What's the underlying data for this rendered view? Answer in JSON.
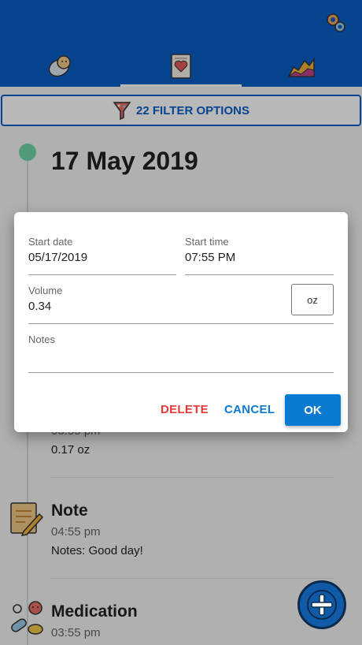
{
  "header": {
    "settings_icon": "gear-icon",
    "tabs": [
      {
        "icon": "baby-icon"
      },
      {
        "icon": "diary-icon",
        "active": true
      },
      {
        "icon": "chart-icon"
      }
    ]
  },
  "filter": {
    "label": "22 FILTER OPTIONS",
    "icon": "funnel-icon"
  },
  "timeline": {
    "date_heading": "17 May 2019",
    "entries": [
      {
        "title": "",
        "time": "03:55 pm",
        "text": "0.17 oz"
      },
      {
        "title": "Note",
        "time": "04:55 pm",
        "text": "Notes: Good day!"
      },
      {
        "title": "Medication",
        "time": "03:55 pm",
        "text": ""
      }
    ]
  },
  "dialog": {
    "start_date_label": "Start date",
    "start_date_value": "05/17/2019",
    "start_time_label": "Start time",
    "start_time_value": "07:55 PM",
    "volume_label": "Volume",
    "volume_value": "0.34",
    "unit_label": "oz",
    "notes_label": "Notes",
    "notes_value": "",
    "delete_label": "DELETE",
    "cancel_label": "CANCEL",
    "ok_label": "OK"
  },
  "colors": {
    "primary": "#0b5fc8",
    "accent": "#0b7ad1",
    "danger": "#e53935",
    "timeline_dot": "#6ed7a8"
  }
}
